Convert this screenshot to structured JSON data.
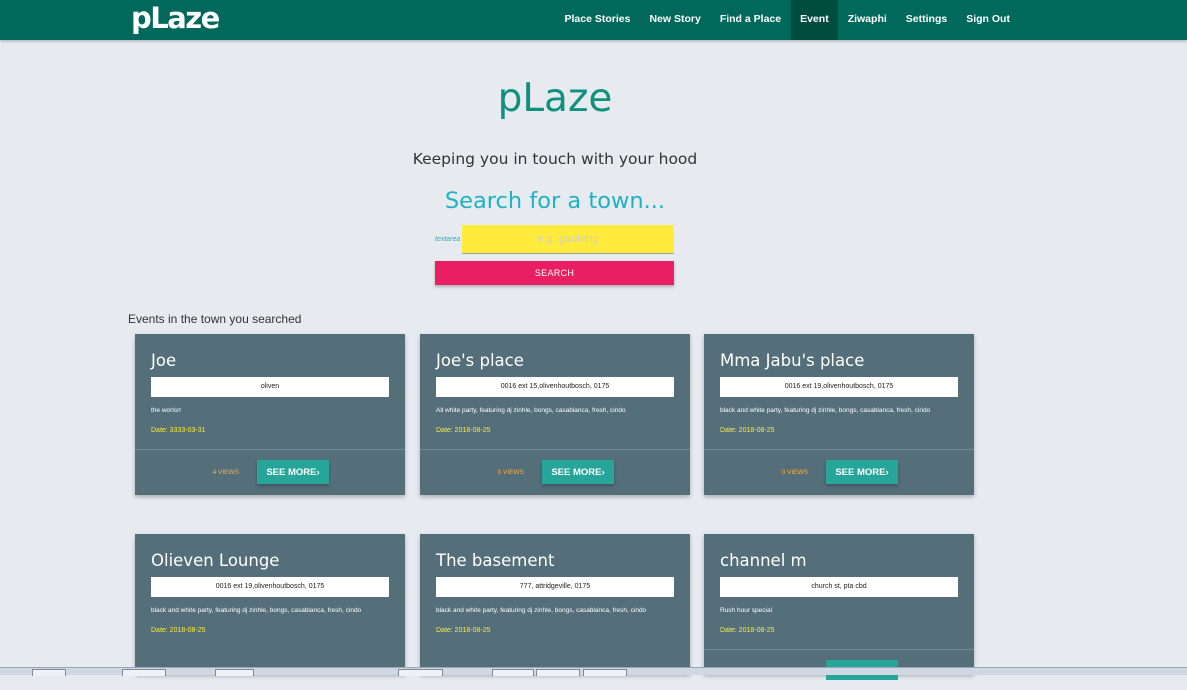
{
  "nav": {
    "brand": "pLaze",
    "items": [
      "Place Stories",
      "New Story",
      "Find a Place",
      "Event",
      "Ziwaphi",
      "Settings",
      "Sign Out"
    ],
    "active": "Event"
  },
  "hero": {
    "title": "pLaze",
    "tagline": "Keeping you in touch with your hood"
  },
  "search": {
    "heading": "Search for a town...",
    "field_label": "textarea",
    "placeholder": "e.g. gauteng",
    "button_label": "SEARCH"
  },
  "events": {
    "heading": "Events in the town you searched",
    "see_more_label": "SEE MORE",
    "cards": [
      {
        "title": "Joe",
        "address": "oliven",
        "description": "the worlsrr",
        "date": "Date: 3333-03-31",
        "views": "4 VIEWS"
      },
      {
        "title": "Joe's place",
        "address": "0016 ext 15,olivenhoutbosch, 0175",
        "description": "All white party, featuring dj zinhle, bongs, casablanca, fresh, cindo",
        "date": "Date: 2018-08-25",
        "views": "0 VIEWS"
      },
      {
        "title": "Mma Jabu's place",
        "address": "0016 ext 19,olivenhoutbosch, 0175",
        "description": "black and white party, featuring dj zinhle, bongs, casablanca, fresh, cindo",
        "date": "Date: 2018-08-25",
        "views": "0 VIEWS"
      },
      {
        "title": "Olieven Lounge",
        "address": "0016 ext 19,olivenhoutbosch, 0175",
        "description": "black and white party, featuring dj zinhle, bongs, casablanca, fresh, cindo",
        "date": "Date: 2018-08-25",
        "views": ""
      },
      {
        "title": "The basement",
        "address": "777, attridgeville, 0175",
        "description": "black and white party, featuring dj zinhle, bongs, casablanca, fresh, cindo",
        "date": "Date: 2018-08-25",
        "views": ""
      },
      {
        "title": "channel m",
        "address": "church st, pta cbd",
        "description": "Rush hour special",
        "date": "Date: 2018-08-25",
        "views": ""
      }
    ]
  },
  "colors": {
    "navbar": "#00695c",
    "accent_teal": "#10917f",
    "search_field": "#ffeb3b",
    "search_button": "#e91e63",
    "card": "#546e7a",
    "see_more_button": "#26a69a",
    "date_text": "#ffeb3b",
    "views_text": "#ffab40"
  }
}
